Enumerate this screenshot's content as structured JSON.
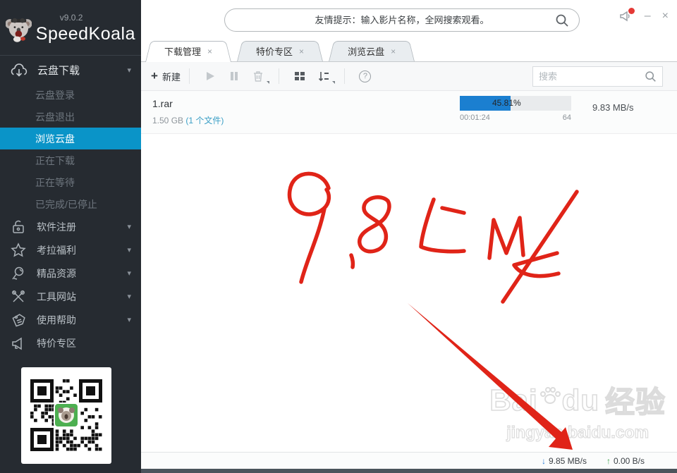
{
  "app": {
    "name": "SpeedKoala",
    "version": "v9.0.2"
  },
  "header": {
    "search_placeholder": "友情提示：输入影片名称，全网搜索观看。"
  },
  "window_controls": {
    "minimize": "–",
    "close": "×"
  },
  "sidebar": {
    "bg_color": "#262b31",
    "active_color": "#0a94c8",
    "group": {
      "label": "云盘下载",
      "icon": "cloud-download-icon"
    },
    "submenu": [
      {
        "label": "云盘登录"
      },
      {
        "label": "云盘退出"
      },
      {
        "label": "浏览云盘",
        "active": true
      },
      {
        "label": "正在下载"
      },
      {
        "label": "正在等待"
      },
      {
        "label": "已完成/已停止"
      }
    ],
    "items": [
      {
        "label": "软件注册",
        "icon": "lock-icon"
      },
      {
        "label": "考拉福利",
        "icon": "star-icon"
      },
      {
        "label": "精品资源",
        "icon": "magnifier-icon"
      },
      {
        "label": "工具网站",
        "icon": "tools-icon"
      },
      {
        "label": "使用帮助",
        "icon": "tag-icon"
      },
      {
        "label": "特价专区",
        "icon": "megaphone-icon"
      }
    ]
  },
  "tabs": [
    {
      "label": "下载管理",
      "active": true
    },
    {
      "label": "特价专区",
      "active": false
    },
    {
      "label": "浏览云盘",
      "active": false
    }
  ],
  "toolbar": {
    "new_label": "新建",
    "search_placeholder": "搜索"
  },
  "download_row": {
    "filename": "1.rar",
    "size": "1.50 GB ",
    "file_count": "(1 个文件)",
    "percent_label": "45.81%",
    "percent_value": 45.81,
    "elapsed": "00:01:24",
    "connections": "64",
    "speed": "9.83 MB/s",
    "progress_color": "#1b7fd0"
  },
  "annotation": {
    "text": "9.85 M/s",
    "color": "#e02418"
  },
  "watermark": {
    "brand_left": "Bai",
    "brand_right": "du",
    "brand_cn": "经验",
    "url": "jingyan.baidu.com"
  },
  "statusbar": {
    "download_speed": "9.85 MB/s",
    "upload_speed": "0.00 B/s",
    "down_color": "#2f7ed8",
    "up_color": "#3da14a"
  },
  "glyphs": {
    "plus": "+",
    "chevron": "▾",
    "close": "×",
    "minimize": "–",
    "help": "?",
    "down_arrow": "↓",
    "up_arrow": "↑"
  }
}
